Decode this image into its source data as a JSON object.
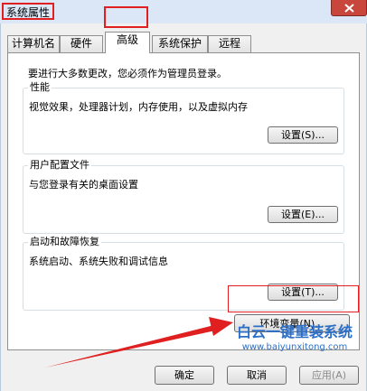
{
  "window": {
    "title": "系统属性"
  },
  "tabs": [
    {
      "label": "计算机名"
    },
    {
      "label": "硬件"
    },
    {
      "label": "高级"
    },
    {
      "label": "系统保护"
    },
    {
      "label": "远程"
    }
  ],
  "panel": {
    "admin_note": "要进行大多数更改，您必须作为管理员登录。",
    "groups": [
      {
        "title": "性能",
        "description": "视觉效果，处理器计划，内存使用，以及虚拟内存",
        "button": "设置(S)..."
      },
      {
        "title": "用户配置文件",
        "description": "与您登录有关的桌面设置",
        "button": "设置(E)..."
      },
      {
        "title": "启动和故障恢复",
        "description": "系统启动、系统失败和调试信息",
        "button": "设置(T)..."
      }
    ],
    "env_button": "环境变量(N)..."
  },
  "footer": {
    "ok": "确定",
    "cancel": "取消",
    "apply": "应用(A)"
  },
  "watermark": {
    "text": "白云一键重装系统",
    "url": "www.baiyunxitong.com"
  },
  "colors": {
    "highlight": "#e02020",
    "watermark": "#2c6fc8"
  },
  "icons": {
    "close": "close-icon",
    "annotation": "red-arrow"
  }
}
